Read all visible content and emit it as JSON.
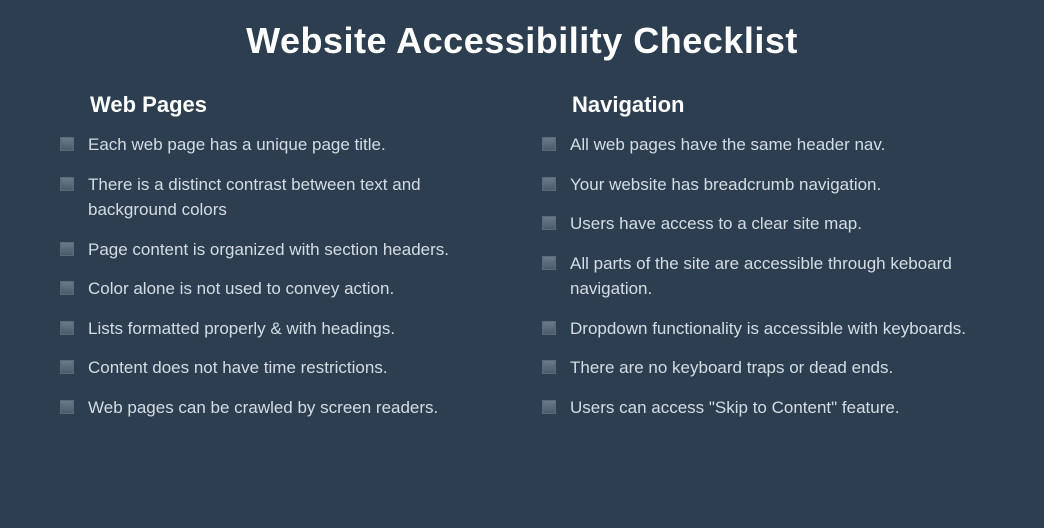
{
  "title": "Website Accessibility Checklist",
  "sections": [
    {
      "heading": "Web Pages",
      "items": [
        "Each web page has a unique page title.",
        "There is a distinct contrast between text and background colors",
        "Page content is organized with section headers.",
        "Color alone is not used to convey action.",
        "Lists formatted properly & with headings.",
        "Content does not have time restrictions.",
        "Web pages can be crawled by screen readers."
      ]
    },
    {
      "heading": "Navigation",
      "items": [
        "All web pages have the same header nav.",
        "Your website has breadcrumb navigation.",
        "Users have access to a clear site map.",
        "All parts of the site are accessible through keboard navigation.",
        "Dropdown functionality is accessible with keyboards.",
        "There are no keyboard traps or dead ends.",
        "Users can access \"Skip to Content\" feature."
      ]
    }
  ]
}
